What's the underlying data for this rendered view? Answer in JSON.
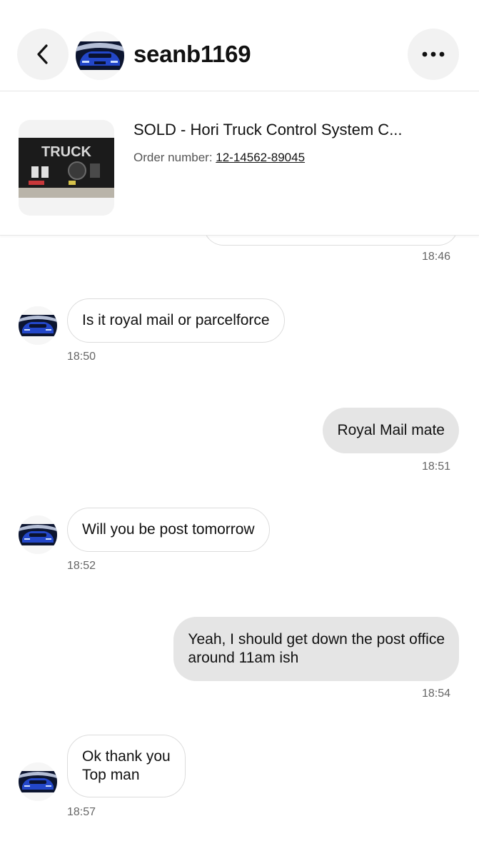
{
  "header": {
    "back_icon": "chevron-left-icon",
    "username": "seanb1169",
    "more_icon": "ellipsis-icon"
  },
  "item": {
    "title": "SOLD - Hori Truck Control System C...",
    "order_label": "Order number: ",
    "order_number": "12-14562-89045",
    "thumbnail_text": "TRUCK"
  },
  "messages": [
    {
      "direction": "outgoing",
      "lines": [],
      "time": "18:46",
      "partial": true
    },
    {
      "direction": "incoming",
      "lines": [
        "Is it royal mail or parcelforce"
      ],
      "time": "18:50"
    },
    {
      "direction": "outgoing",
      "lines": [
        "Royal Mail mate"
      ],
      "time": "18:51"
    },
    {
      "direction": "incoming",
      "lines": [
        "Will you be post tomorrow"
      ],
      "time": "18:52"
    },
    {
      "direction": "outgoing",
      "lines": [
        "Yeah, I should get down the post office",
        "around 11am ish"
      ],
      "time": "18:54"
    },
    {
      "direction": "incoming",
      "lines": [
        "Ok thank you",
        "Top man"
      ],
      "time": "18:57"
    }
  ],
  "colors": {
    "outgoing_bubble": "#e5e5e5",
    "incoming_border": "#dcdcdc",
    "button_bg": "#f2f2f2",
    "avatar_car": "#1f3fb5"
  }
}
